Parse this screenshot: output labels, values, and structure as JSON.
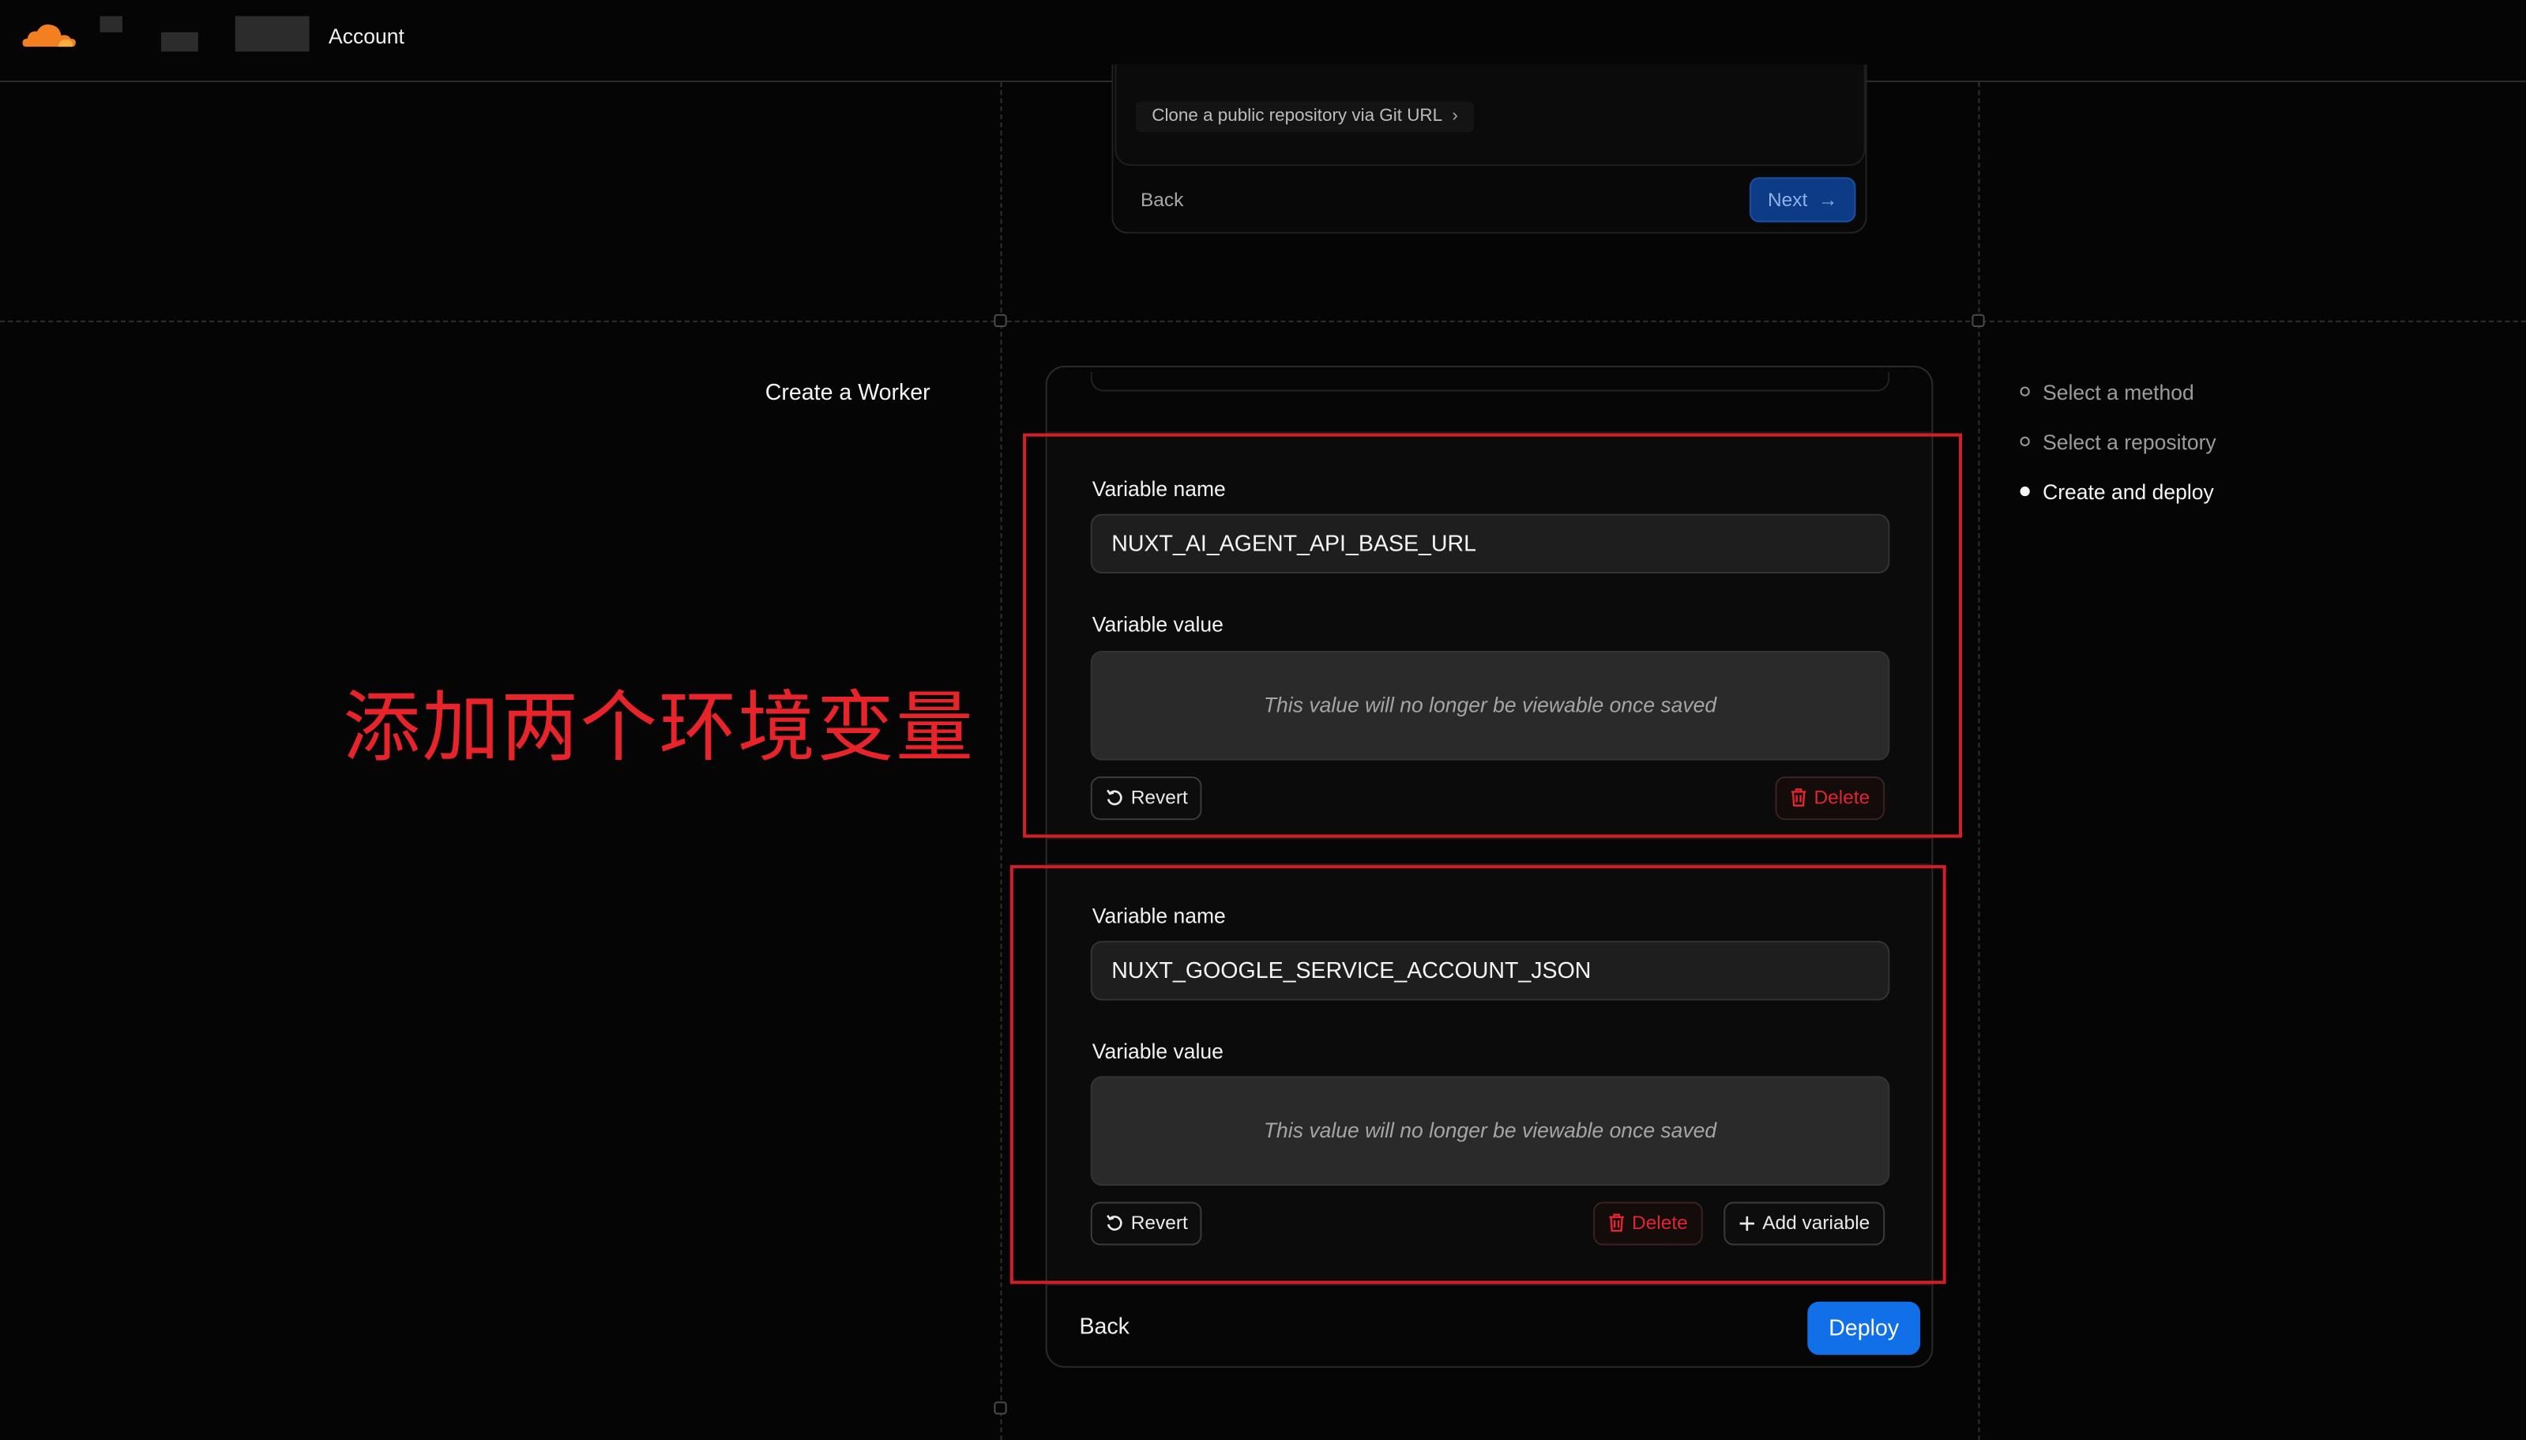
{
  "nav": {
    "account_label": "Account"
  },
  "upper_step": {
    "clone_link": "Clone a public repository via Git URL",
    "back_label": "Back",
    "next_label": "Next"
  },
  "page": {
    "title": "Create a Worker",
    "annotation": "添加两个环境变量"
  },
  "stepper": [
    {
      "label": "Select a method",
      "state": "complete"
    },
    {
      "label": "Select a repository",
      "state": "complete"
    },
    {
      "label": "Create and deploy",
      "state": "current"
    }
  ],
  "variables": [
    {
      "name_label": "Variable name",
      "name_value": "NUXT_AI_AGENT_API_BASE_URL",
      "value_label": "Variable value",
      "value_placeholder": "This value will no longer be viewable once saved",
      "revert_label": "Revert",
      "delete_label": "Delete"
    },
    {
      "name_label": "Variable name",
      "name_value": "NUXT_GOOGLE_SERVICE_ACCOUNT_JSON",
      "value_label": "Variable value",
      "value_placeholder": "This value will no longer be viewable once saved",
      "revert_label": "Revert",
      "delete_label": "Delete",
      "add_label": "Add variable"
    }
  ],
  "footer": {
    "back_label": "Back",
    "deploy_label": "Deploy"
  },
  "colors": {
    "accent": "#1170e8",
    "danger": "#e1262d",
    "annotation": "#d11f27",
    "brand_orange": "#f38020"
  }
}
